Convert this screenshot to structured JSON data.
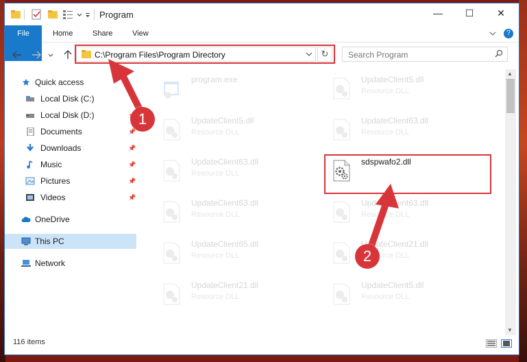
{
  "window": {
    "title": "Program",
    "controls": {
      "minimize": "—",
      "maximize": "☐",
      "close": "✕"
    }
  },
  "ribbon": {
    "tabs": [
      "File",
      "Home",
      "Share",
      "View"
    ],
    "expand_icon": "chevron-down-icon",
    "help_icon": "?"
  },
  "address": {
    "path": "C:\\Program Files\\Program Directory",
    "refresh": "↻"
  },
  "search": {
    "placeholder": "Search Program"
  },
  "nav": {
    "items": [
      {
        "label": "Quick access",
        "icon": "star-icon",
        "pinned": false
      },
      {
        "label": "Local Disk (C:)",
        "icon": "drive-icon",
        "pinned": false
      },
      {
        "label": "Local Disk (D:)",
        "icon": "drive-icon",
        "pinned": true
      },
      {
        "label": "Documents",
        "icon": "documents-icon",
        "pinned": true
      },
      {
        "label": "Downloads",
        "icon": "downloads-icon",
        "pinned": true
      },
      {
        "label": "Music",
        "icon": "music-icon",
        "pinned": true
      },
      {
        "label": "Pictures",
        "icon": "pictures-icon",
        "pinned": true
      },
      {
        "label": "Videos",
        "icon": "videos-icon",
        "pinned": true
      },
      {
        "label": "OneDrive",
        "icon": "cloud-icon",
        "pinned": false
      },
      {
        "label": "This PC",
        "icon": "pc-icon",
        "pinned": false,
        "selected": true
      },
      {
        "label": "Network",
        "icon": "network-icon",
        "pinned": false
      }
    ]
  },
  "files": [
    {
      "name": "program.exe",
      "type": "",
      "highlighted": false
    },
    {
      "name": "UpdateClient5.dll",
      "type": "Resource DLL",
      "highlighted": false
    },
    {
      "name": "UpdateClient5.dll",
      "type": "Resource DLL",
      "highlighted": false
    },
    {
      "name": "UpdateClient63.dll",
      "type": "Resource DLL",
      "highlighted": false
    },
    {
      "name": "UpdateClient63.dll",
      "type": "Resource DLL",
      "highlighted": false
    },
    {
      "name": "sdspwafo2.dll",
      "type": "",
      "highlighted": true
    },
    {
      "name": "UpdateClient63.dll",
      "type": "Resource DLL",
      "highlighted": false
    },
    {
      "name": "UpdateClient63.dll",
      "type": "Resource DLL",
      "highlighted": false
    },
    {
      "name": "UpdateClient65.dll",
      "type": "Resource DLL",
      "highlighted": false
    },
    {
      "name": "UpdateClient21.dll",
      "type": "Resource DLL",
      "highlighted": false
    },
    {
      "name": "UpdateClient21.dll",
      "type": "Resource DLL",
      "highlighted": false
    },
    {
      "name": "UpdateClient5.dll",
      "type": "Resource DLL",
      "highlighted": false
    }
  ],
  "status": {
    "count": "116 items"
  },
  "annotations": {
    "badge1": "1",
    "badge2": "2"
  },
  "colors": {
    "accent": "#1979ca",
    "highlight": "#d8343a",
    "selected": "#cce4f7"
  }
}
